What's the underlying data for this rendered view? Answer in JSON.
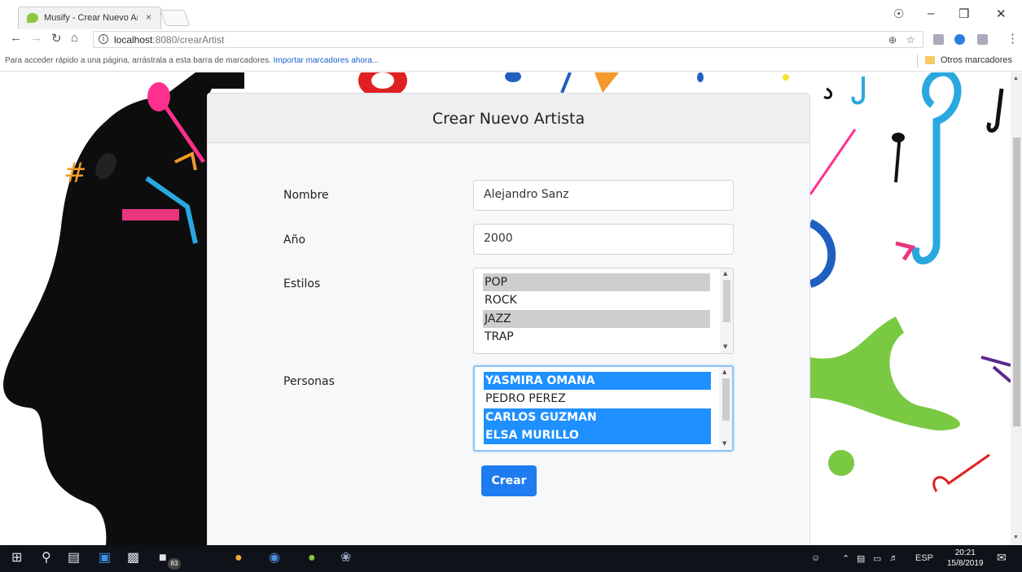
{
  "browser": {
    "tab_title": "Musify - Crear Nuevo Arti",
    "tab_close": "×",
    "url_host": "localhost",
    "url_path": ":8080/crearArtist",
    "bookmarks_hint": "Para acceder rápido a una página, arrástrala a esta barra de marcadores.",
    "bookmarks_import": "Importar marcadores ahora...",
    "other_bookmarks": "Otros marcadores"
  },
  "form": {
    "title": "Crear Nuevo Artista",
    "fields": {
      "nombre": {
        "label": "Nombre",
        "value": "Alejandro Sanz"
      },
      "anio": {
        "label": "Año",
        "value": "2000"
      },
      "estilos": {
        "label": "Estilos"
      },
      "personas": {
        "label": "Personas"
      }
    },
    "estilos_options": [
      {
        "label": "POP",
        "selected": true
      },
      {
        "label": "ROCK",
        "selected": false
      },
      {
        "label": "JAZZ",
        "selected": true
      },
      {
        "label": "TRAP",
        "selected": false
      }
    ],
    "personas_options": [
      {
        "label": "YASMIRA OMANA",
        "selected": true
      },
      {
        "label": "PEDRO PEREZ",
        "selected": false
      },
      {
        "label": "CARLOS GUZMAN",
        "selected": true
      },
      {
        "label": "ELSA MURILLO",
        "selected": true
      }
    ],
    "submit_label": "Crear"
  },
  "taskbar": {
    "badge_count": "83",
    "language": "ESP",
    "time": "20:21",
    "date": "15/8/2019"
  },
  "colors": {
    "accent": "#1f7cf0",
    "selection_blue": "#1e90ff",
    "selection_grey": "#cecece"
  }
}
